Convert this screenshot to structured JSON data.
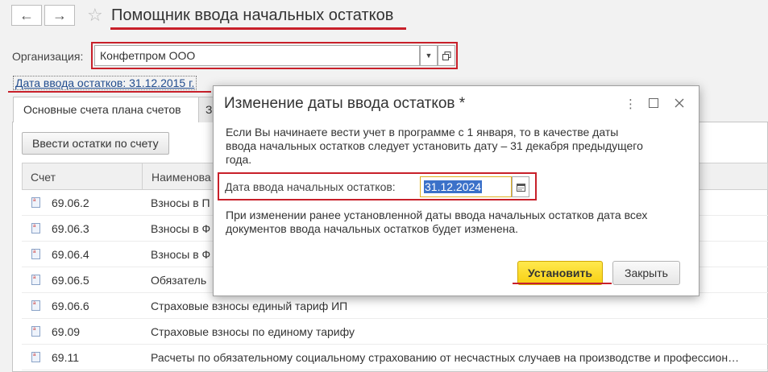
{
  "header": {
    "title": "Помощник ввода начальных остатков"
  },
  "organization": {
    "label": "Организация:",
    "value": "Конфетпром ООО"
  },
  "date_link": "Дата ввода остатков: 31.12.2015 г.",
  "tabs": [
    {
      "label": "Основные счета плана счетов"
    },
    {
      "label": "З"
    }
  ],
  "enter_balance_button": "Ввести остатки по счету",
  "table": {
    "columns": [
      "Счет",
      "Наименова"
    ],
    "rows": [
      {
        "account": "69.06.2",
        "name": "Взносы в П"
      },
      {
        "account": "69.06.3",
        "name": "Взносы в Ф"
      },
      {
        "account": "69.06.4",
        "name": "Взносы в Ф"
      },
      {
        "account": "69.06.5",
        "name": "Обязатель"
      },
      {
        "account": "69.06.6",
        "name": "Страховые взносы единый тариф ИП"
      },
      {
        "account": "69.09",
        "name": "Страховые взносы по единому тарифу"
      },
      {
        "account": "69.11",
        "name": "Расчеты по обязательному социальному страхованию от несчастных случаев на производстве и профессион…"
      }
    ]
  },
  "dialog": {
    "title": "Изменение даты ввода остатков *",
    "paragraph1_line1": "Если Вы начинаете вести учет в программе с 1 января, то в качестве даты",
    "paragraph1_line2": "ввода начальных остатков следует установить дату – 31 декабря предыдущего",
    "paragraph1_line3": "года.",
    "date_label": "Дата ввода начальных остатков:",
    "date_value": "31.12.2024",
    "paragraph2_line1": "При изменении ранее установленной даты ввода начальных остатков дата всех",
    "paragraph2_line2": "документов ввода начальных остатков будет изменена.",
    "set_button": "Установить",
    "close_button": "Закрыть"
  },
  "colors": {
    "highlight_red": "#c8202a",
    "primary_button": "#f7cf12",
    "link": "#224d8f",
    "selection": "#3b71c9"
  }
}
